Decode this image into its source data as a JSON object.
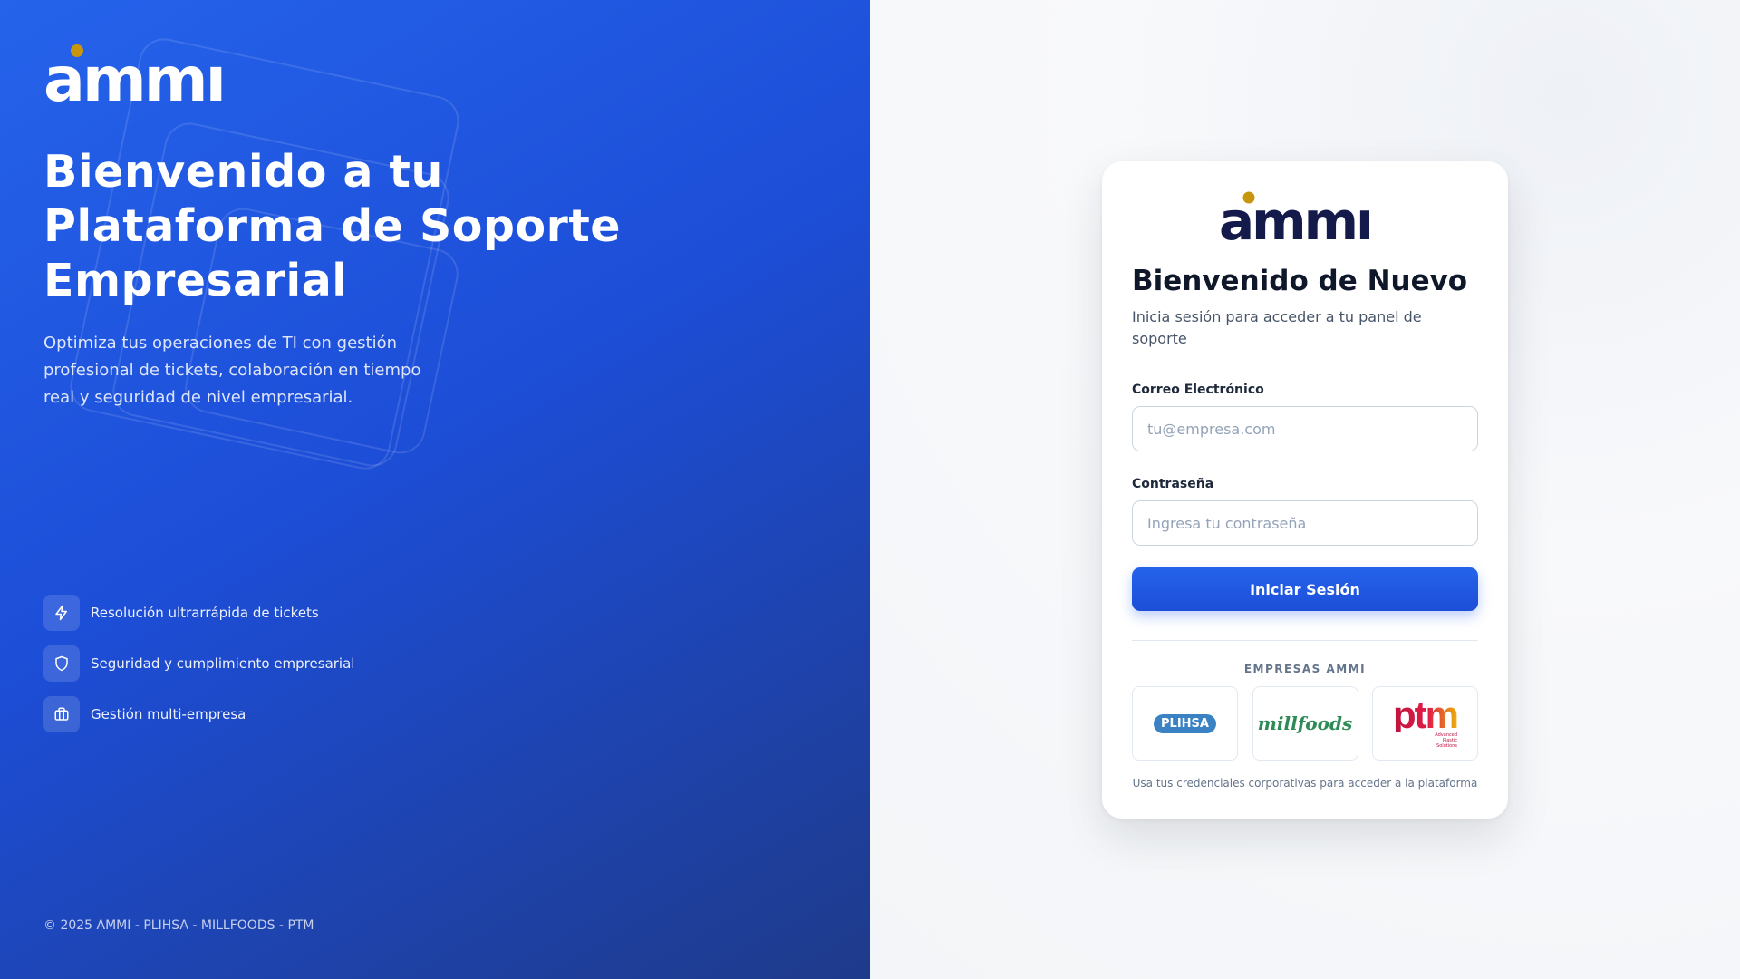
{
  "brand": {
    "logo_text": "ammi",
    "dot_color": "#c8960c",
    "left_logo_color": "#ffffff",
    "card_logo_color": "#141a4a"
  },
  "hero": {
    "title": "Bienvenido a tu Plataforma de Soporte Empresarial",
    "subtitle": "Optimiza tus operaciones de TI con gestión profesional de tickets, colaboración en tiempo real y seguridad de nivel empresarial."
  },
  "features": [
    {
      "icon": "lightning-icon",
      "label": "Resolución ultrarrápida de tickets"
    },
    {
      "icon": "shield-icon",
      "label": "Seguridad y cumplimiento empresarial"
    },
    {
      "icon": "briefcase-icon",
      "label": "Gestión multi-empresa"
    }
  ],
  "footer": {
    "copyright": "© 2025 AMMI - PLIHSA - MILLFOODS - PTM"
  },
  "login": {
    "title": "Bienvenido de Nuevo",
    "subtitle": "Inicia sesión para acceder a tu panel de soporte",
    "email_label": "Correo Electrónico",
    "email_placeholder": "tu@empresa.com",
    "email_value": "",
    "password_label": "Contraseña",
    "password_placeholder": "Ingresa tu contraseña",
    "password_value": "",
    "submit_label": "Iniciar Sesión",
    "companies_title": "EMPRESAS AMMI",
    "companies": [
      {
        "name": "PLIHSA",
        "color": "#3b82c4"
      },
      {
        "name": "millfoods",
        "color": "#2e8b57"
      },
      {
        "name": "ptm",
        "tagline": "Advanced Plastic Solutions",
        "color": "#be123c"
      }
    ],
    "footnote": "Usa tus credenciales corporativas para acceder a la plataforma"
  },
  "colors": {
    "accent": "#2563eb",
    "panel_gradient_start": "#2563eb",
    "panel_gradient_end": "#1e3a8a"
  }
}
